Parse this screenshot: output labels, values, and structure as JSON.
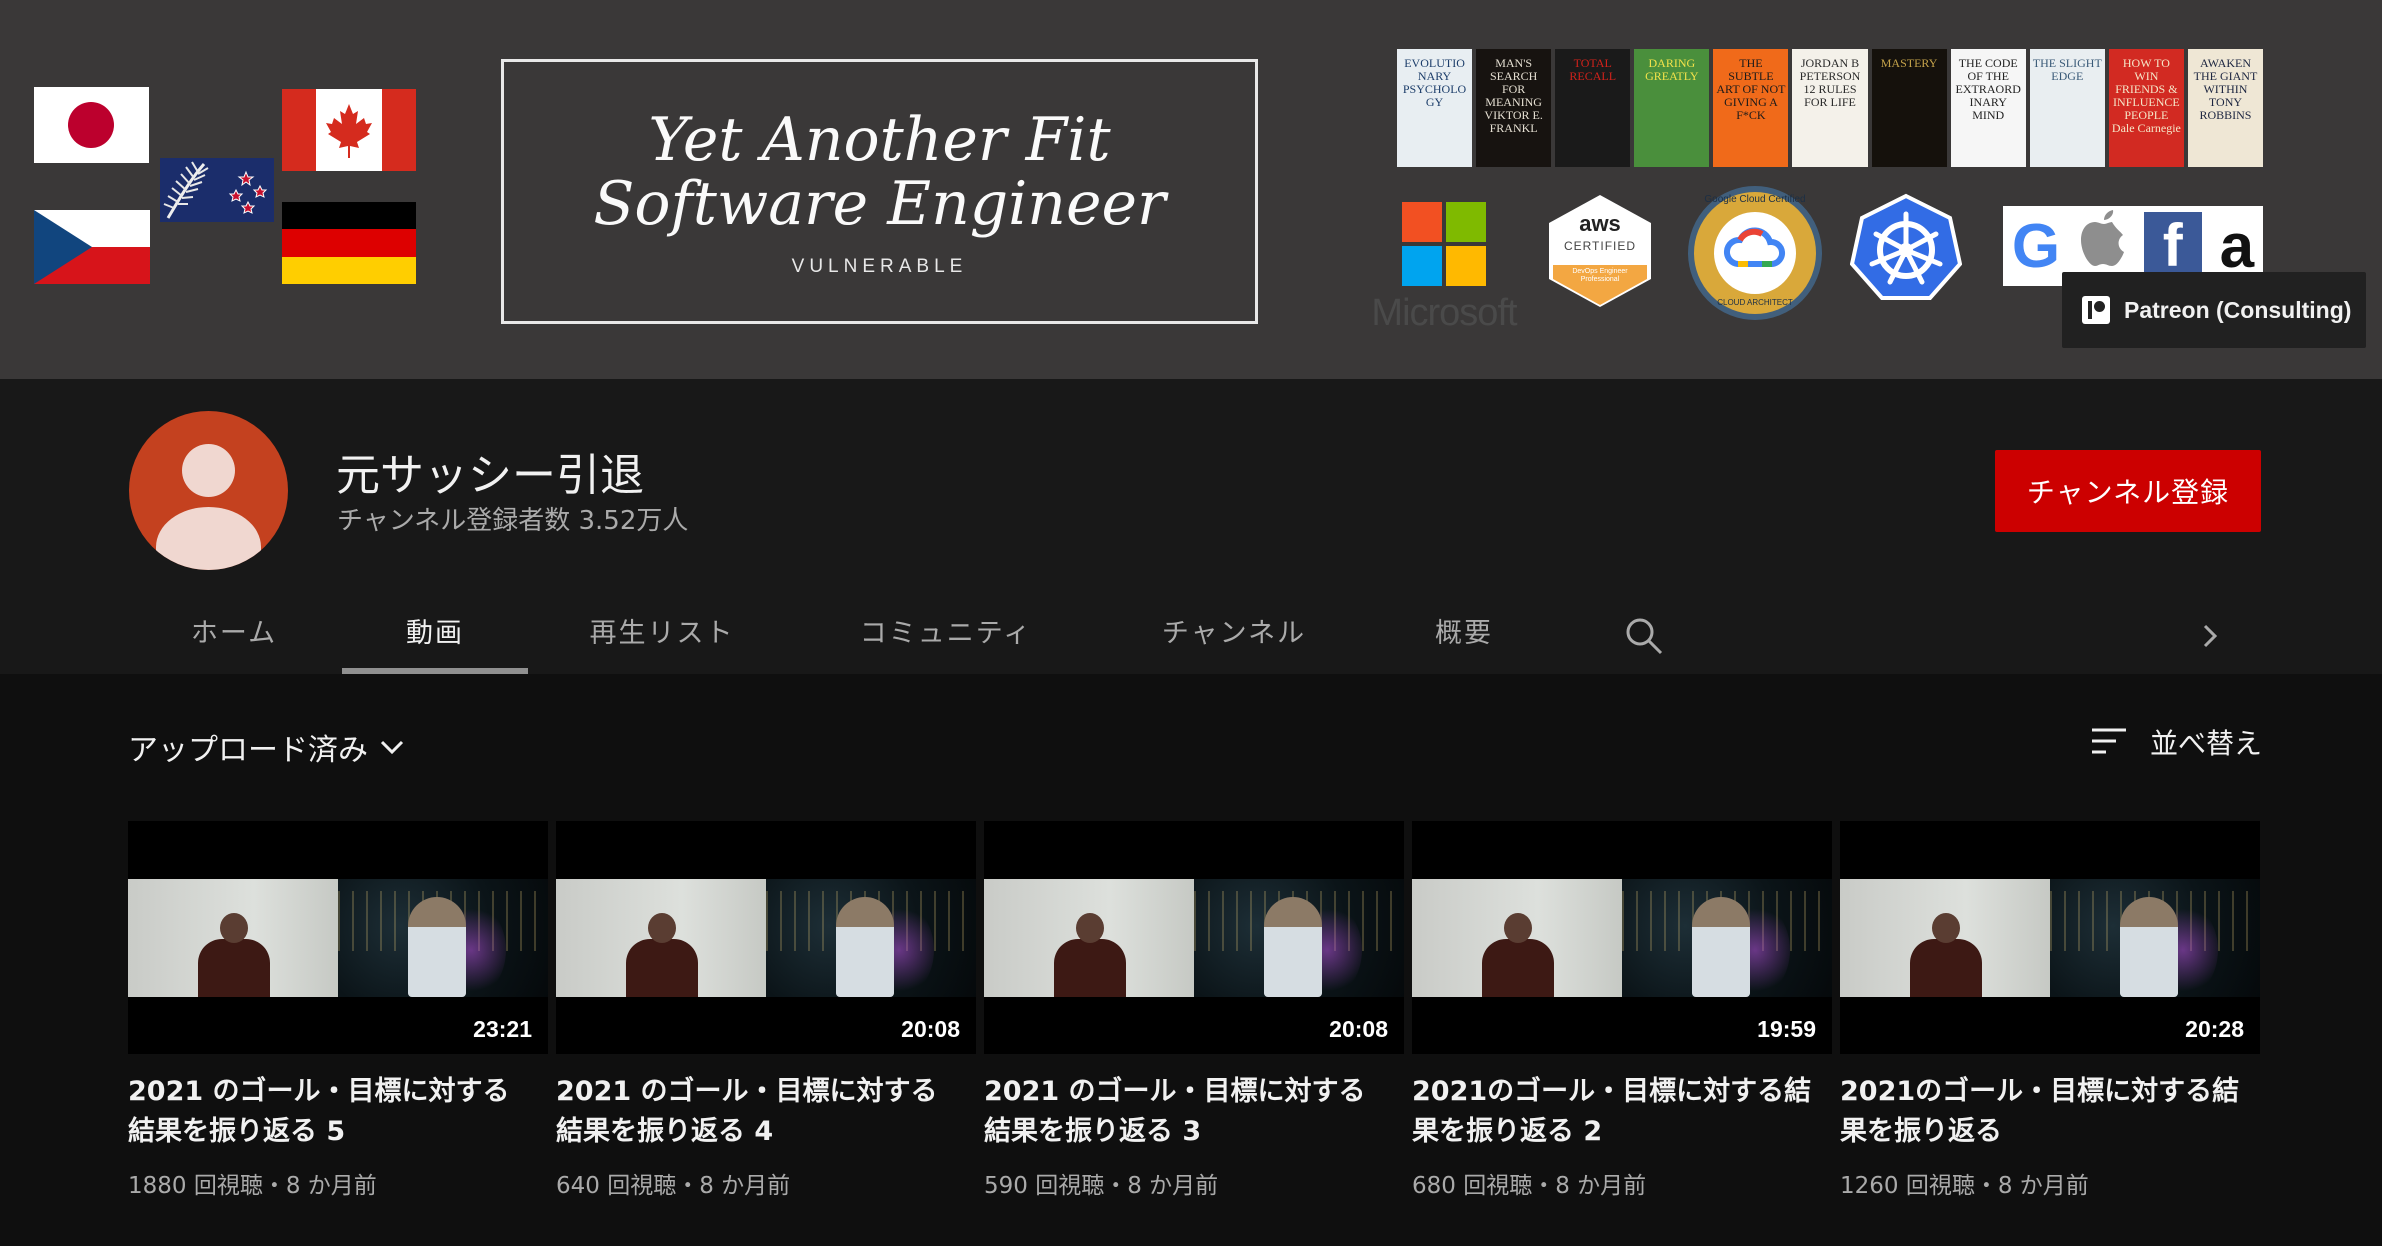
{
  "banner": {
    "title_line1": "Yet Another Fit",
    "title_line2": "Software Engineer",
    "subtitle": "VULNERABLE",
    "books": [
      {
        "title": "EVOLUTIONARY PSYCHOLOGY",
        "bg": "#e8eef2",
        "fg": "#1c3d6a"
      },
      {
        "title": "MAN'S SEARCH FOR MEANING VIKTOR E. FRANKL",
        "bg": "#171310",
        "fg": "#e6e0d3"
      },
      {
        "title": "TOTAL RECALL",
        "bg": "#1a1a1a",
        "fg": "#d2221b"
      },
      {
        "title": "DARING GREATLY",
        "bg": "#4a8f3c",
        "fg": "#f2e24a"
      },
      {
        "title": "THE SUBTLE ART OF NOT GIVING A F*CK",
        "bg": "#f06a1a",
        "fg": "#1a1a1a"
      },
      {
        "title": "JORDAN B PETERSON 12 RULES FOR LIFE",
        "bg": "#f4f1ea",
        "fg": "#2a2a2a"
      },
      {
        "title": "MASTERY",
        "bg": "#15110c",
        "fg": "#c4a24a"
      },
      {
        "title": "THE CODE OF THE EXTRAORDINARY MIND",
        "bg": "#f6f6f6",
        "fg": "#222222"
      },
      {
        "title": "THE SLIGHT EDGE",
        "bg": "#e9eef1",
        "fg": "#3a5a78"
      },
      {
        "title": "HOW TO WIN FRIENDS & INFLUENCE PEOPLE Dale Carnegie",
        "bg": "#d22a22",
        "fg": "#f5e6c8"
      },
      {
        "title": "AWAKEN THE GIANT WITHIN TONY ROBBINS",
        "bg": "#efe7d5",
        "fg": "#1c2540"
      }
    ],
    "microsoft_label": "Microsoft",
    "aws_label": "aws",
    "aws_sub": "CERTIFIED",
    "aws_level": "DevOps Engineer Professional",
    "gcp_label": "Google Cloud Certified",
    "gcp_sub": "CLOUD ARCHITECT",
    "tech_logos": [
      "G",
      "",
      "f",
      "a"
    ],
    "patreon_label": "Patreon (Consulting)"
  },
  "channel": {
    "name": "元サッシー引退",
    "subscribers": "チャンネル登録者数 3.52万人",
    "subscribe_label": "チャンネル登録",
    "accent": "#cc0000"
  },
  "tabs": [
    "ホーム",
    "動画",
    "再生リスト",
    "コミュニティ",
    "チャンネル",
    "概要"
  ],
  "active_tab": "動画",
  "filter_label": "アップロード済み",
  "sort_label": "並べ替え",
  "videos": [
    {
      "title": "2021 のゴール・目標に対する結果を振り返る 5",
      "duration": "23:21",
      "meta": "1880 回視聴・8 か月前"
    },
    {
      "title": "2021 のゴール・目標に対する結果を振り返る 4",
      "duration": "20:08",
      "meta": "640 回視聴・8 か月前"
    },
    {
      "title": "2021 のゴール・目標に対する結果を振り返る 3",
      "duration": "20:08",
      "meta": "590 回視聴・8 か月前"
    },
    {
      "title": "2021のゴール・目標に対する結果を振り返る 2",
      "duration": "19:59",
      "meta": "680 回視聴・8 か月前"
    },
    {
      "title": "2021のゴール・目標に対する結果を振り返る",
      "duration": "20:28",
      "meta": "1260 回視聴・8 か月前"
    }
  ]
}
